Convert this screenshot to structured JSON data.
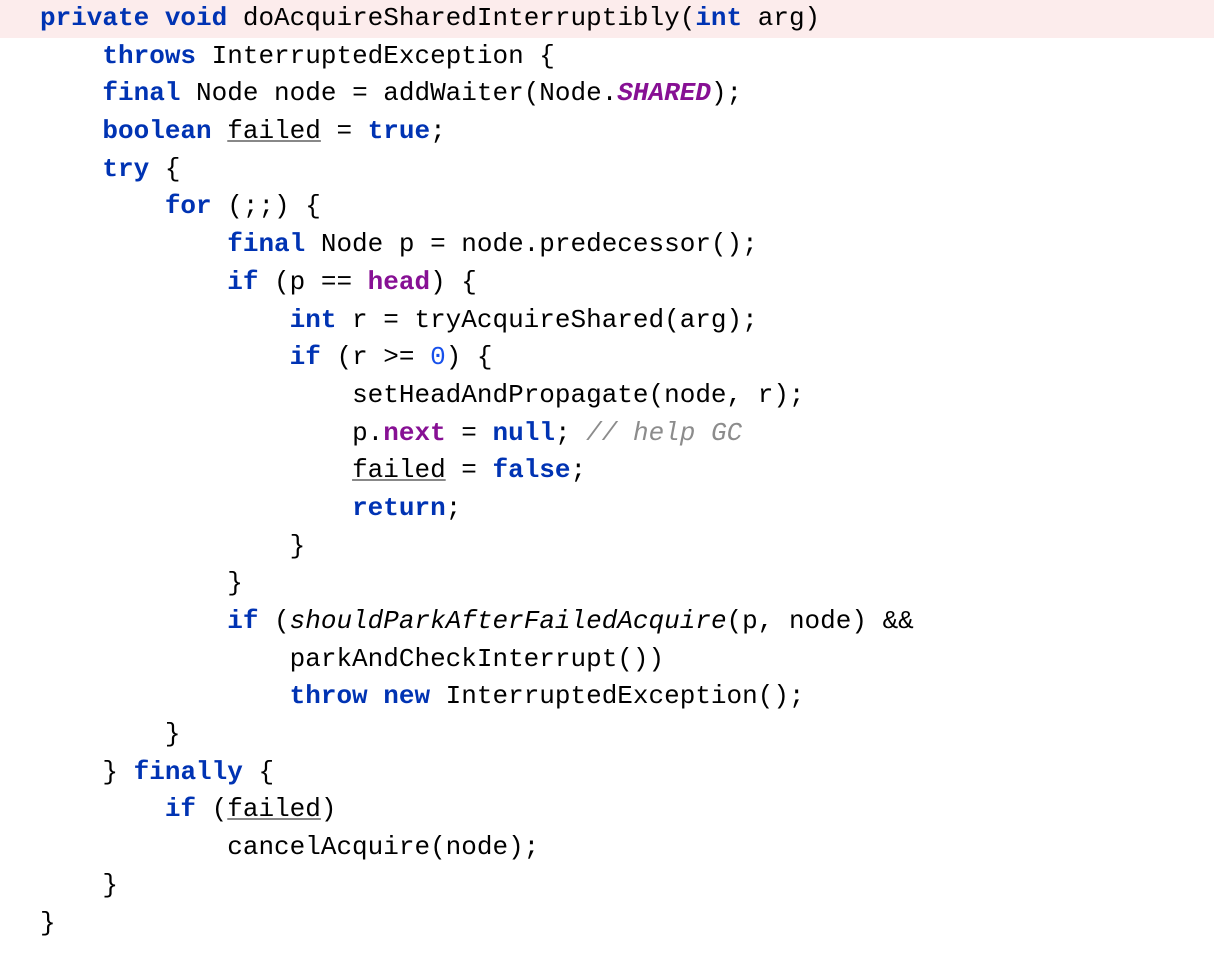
{
  "code": {
    "lines": [
      {
        "highlighted": true,
        "indent": 0,
        "segments": [
          {
            "text": "private",
            "cls": "keyword"
          },
          {
            "text": " ",
            "cls": ""
          },
          {
            "text": "void",
            "cls": "keyword"
          },
          {
            "text": " doAcquireSharedInterruptibly(",
            "cls": ""
          },
          {
            "text": "int",
            "cls": "keyword"
          },
          {
            "text": " arg)",
            "cls": ""
          }
        ]
      },
      {
        "indent": 2,
        "segments": [
          {
            "text": "throws",
            "cls": "keyword"
          },
          {
            "text": " InterruptedException {",
            "cls": ""
          }
        ]
      },
      {
        "indent": 2,
        "segments": [
          {
            "text": "final",
            "cls": "keyword"
          },
          {
            "text": " Node node = addWaiter(Node.",
            "cls": ""
          },
          {
            "text": "SHARED",
            "cls": "static-field"
          },
          {
            "text": ");",
            "cls": ""
          }
        ]
      },
      {
        "indent": 2,
        "segments": [
          {
            "text": "boolean",
            "cls": "keyword"
          },
          {
            "text": " ",
            "cls": ""
          },
          {
            "text": "failed",
            "cls": "underline"
          },
          {
            "text": " = ",
            "cls": ""
          },
          {
            "text": "true",
            "cls": "keyword"
          },
          {
            "text": ";",
            "cls": ""
          }
        ]
      },
      {
        "indent": 2,
        "segments": [
          {
            "text": "try",
            "cls": "keyword"
          },
          {
            "text": " {",
            "cls": ""
          }
        ]
      },
      {
        "indent": 4,
        "segments": [
          {
            "text": "for",
            "cls": "keyword"
          },
          {
            "text": " (;;) {",
            "cls": ""
          }
        ]
      },
      {
        "indent": 6,
        "segments": [
          {
            "text": "final",
            "cls": "keyword"
          },
          {
            "text": " Node p = node.predecessor();",
            "cls": ""
          }
        ]
      },
      {
        "indent": 6,
        "segments": [
          {
            "text": "if",
            "cls": "keyword"
          },
          {
            "text": " (p == ",
            "cls": ""
          },
          {
            "text": "head",
            "cls": "field-bold"
          },
          {
            "text": ") {",
            "cls": ""
          }
        ]
      },
      {
        "indent": 8,
        "segments": [
          {
            "text": "int",
            "cls": "keyword"
          },
          {
            "text": " r = tryAcquireShared(arg);",
            "cls": ""
          }
        ]
      },
      {
        "indent": 8,
        "segments": [
          {
            "text": "if",
            "cls": "keyword"
          },
          {
            "text": " (r >= ",
            "cls": ""
          },
          {
            "text": "0",
            "cls": "number"
          },
          {
            "text": ") {",
            "cls": ""
          }
        ]
      },
      {
        "indent": 10,
        "segments": [
          {
            "text": "setHeadAndPropagate(node, r);",
            "cls": ""
          }
        ]
      },
      {
        "indent": 10,
        "segments": [
          {
            "text": "p.",
            "cls": ""
          },
          {
            "text": "next",
            "cls": "field-bold"
          },
          {
            "text": " = ",
            "cls": ""
          },
          {
            "text": "null",
            "cls": "keyword"
          },
          {
            "text": "; ",
            "cls": ""
          },
          {
            "text": "// help GC",
            "cls": "comment"
          }
        ]
      },
      {
        "indent": 10,
        "segments": [
          {
            "text": "failed",
            "cls": "underline"
          },
          {
            "text": " = ",
            "cls": ""
          },
          {
            "text": "false",
            "cls": "keyword"
          },
          {
            "text": ";",
            "cls": ""
          }
        ]
      },
      {
        "indent": 10,
        "segments": [
          {
            "text": "return",
            "cls": "keyword"
          },
          {
            "text": ";",
            "cls": ""
          }
        ]
      },
      {
        "indent": 8,
        "segments": [
          {
            "text": "}",
            "cls": ""
          }
        ]
      },
      {
        "indent": 6,
        "segments": [
          {
            "text": "}",
            "cls": ""
          }
        ]
      },
      {
        "indent": 6,
        "segments": [
          {
            "text": "if",
            "cls": "keyword"
          },
          {
            "text": " (",
            "cls": ""
          },
          {
            "text": "shouldParkAfterFailedAcquire",
            "cls": "static-method"
          },
          {
            "text": "(p, node) &&",
            "cls": ""
          }
        ]
      },
      {
        "indent": 8,
        "segments": [
          {
            "text": "parkAndCheckInterrupt())",
            "cls": ""
          }
        ]
      },
      {
        "indent": 8,
        "segments": [
          {
            "text": "throw",
            "cls": "keyword"
          },
          {
            "text": " ",
            "cls": ""
          },
          {
            "text": "new",
            "cls": "keyword"
          },
          {
            "text": " InterruptedException();",
            "cls": ""
          }
        ]
      },
      {
        "indent": 4,
        "segments": [
          {
            "text": "}",
            "cls": ""
          }
        ]
      },
      {
        "indent": 2,
        "segments": [
          {
            "text": "} ",
            "cls": ""
          },
          {
            "text": "finally",
            "cls": "keyword"
          },
          {
            "text": " {",
            "cls": ""
          }
        ]
      },
      {
        "indent": 4,
        "segments": [
          {
            "text": "if",
            "cls": "keyword"
          },
          {
            "text": " (",
            "cls": ""
          },
          {
            "text": "failed",
            "cls": "underline"
          },
          {
            "text": ")",
            "cls": ""
          }
        ]
      },
      {
        "indent": 6,
        "segments": [
          {
            "text": "cancelAcquire(node);",
            "cls": ""
          }
        ]
      },
      {
        "indent": 2,
        "segments": [
          {
            "text": "}",
            "cls": ""
          }
        ]
      },
      {
        "indent": 0,
        "segments": [
          {
            "text": "}",
            "cls": ""
          }
        ]
      }
    ]
  }
}
